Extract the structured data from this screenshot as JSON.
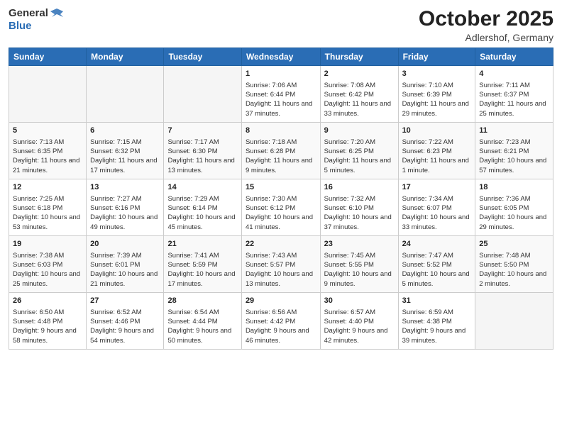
{
  "header": {
    "logo_general": "General",
    "logo_blue": "Blue",
    "month": "October 2025",
    "location": "Adlershof, Germany"
  },
  "weekdays": [
    "Sunday",
    "Monday",
    "Tuesday",
    "Wednesday",
    "Thursday",
    "Friday",
    "Saturday"
  ],
  "weeks": [
    [
      {
        "day": "",
        "sunrise": "",
        "sunset": "",
        "daylight": ""
      },
      {
        "day": "",
        "sunrise": "",
        "sunset": "",
        "daylight": ""
      },
      {
        "day": "",
        "sunrise": "",
        "sunset": "",
        "daylight": ""
      },
      {
        "day": "1",
        "sunrise": "Sunrise: 7:06 AM",
        "sunset": "Sunset: 6:44 PM",
        "daylight": "Daylight: 11 hours and 37 minutes."
      },
      {
        "day": "2",
        "sunrise": "Sunrise: 7:08 AM",
        "sunset": "Sunset: 6:42 PM",
        "daylight": "Daylight: 11 hours and 33 minutes."
      },
      {
        "day": "3",
        "sunrise": "Sunrise: 7:10 AM",
        "sunset": "Sunset: 6:39 PM",
        "daylight": "Daylight: 11 hours and 29 minutes."
      },
      {
        "day": "4",
        "sunrise": "Sunrise: 7:11 AM",
        "sunset": "Sunset: 6:37 PM",
        "daylight": "Daylight: 11 hours and 25 minutes."
      }
    ],
    [
      {
        "day": "5",
        "sunrise": "Sunrise: 7:13 AM",
        "sunset": "Sunset: 6:35 PM",
        "daylight": "Daylight: 11 hours and 21 minutes."
      },
      {
        "day": "6",
        "sunrise": "Sunrise: 7:15 AM",
        "sunset": "Sunset: 6:32 PM",
        "daylight": "Daylight: 11 hours and 17 minutes."
      },
      {
        "day": "7",
        "sunrise": "Sunrise: 7:17 AM",
        "sunset": "Sunset: 6:30 PM",
        "daylight": "Daylight: 11 hours and 13 minutes."
      },
      {
        "day": "8",
        "sunrise": "Sunrise: 7:18 AM",
        "sunset": "Sunset: 6:28 PM",
        "daylight": "Daylight: 11 hours and 9 minutes."
      },
      {
        "day": "9",
        "sunrise": "Sunrise: 7:20 AM",
        "sunset": "Sunset: 6:25 PM",
        "daylight": "Daylight: 11 hours and 5 minutes."
      },
      {
        "day": "10",
        "sunrise": "Sunrise: 7:22 AM",
        "sunset": "Sunset: 6:23 PM",
        "daylight": "Daylight: 11 hours and 1 minute."
      },
      {
        "day": "11",
        "sunrise": "Sunrise: 7:23 AM",
        "sunset": "Sunset: 6:21 PM",
        "daylight": "Daylight: 10 hours and 57 minutes."
      }
    ],
    [
      {
        "day": "12",
        "sunrise": "Sunrise: 7:25 AM",
        "sunset": "Sunset: 6:18 PM",
        "daylight": "Daylight: 10 hours and 53 minutes."
      },
      {
        "day": "13",
        "sunrise": "Sunrise: 7:27 AM",
        "sunset": "Sunset: 6:16 PM",
        "daylight": "Daylight: 10 hours and 49 minutes."
      },
      {
        "day": "14",
        "sunrise": "Sunrise: 7:29 AM",
        "sunset": "Sunset: 6:14 PM",
        "daylight": "Daylight: 10 hours and 45 minutes."
      },
      {
        "day": "15",
        "sunrise": "Sunrise: 7:30 AM",
        "sunset": "Sunset: 6:12 PM",
        "daylight": "Daylight: 10 hours and 41 minutes."
      },
      {
        "day": "16",
        "sunrise": "Sunrise: 7:32 AM",
        "sunset": "Sunset: 6:10 PM",
        "daylight": "Daylight: 10 hours and 37 minutes."
      },
      {
        "day": "17",
        "sunrise": "Sunrise: 7:34 AM",
        "sunset": "Sunset: 6:07 PM",
        "daylight": "Daylight: 10 hours and 33 minutes."
      },
      {
        "day": "18",
        "sunrise": "Sunrise: 7:36 AM",
        "sunset": "Sunset: 6:05 PM",
        "daylight": "Daylight: 10 hours and 29 minutes."
      }
    ],
    [
      {
        "day": "19",
        "sunrise": "Sunrise: 7:38 AM",
        "sunset": "Sunset: 6:03 PM",
        "daylight": "Daylight: 10 hours and 25 minutes."
      },
      {
        "day": "20",
        "sunrise": "Sunrise: 7:39 AM",
        "sunset": "Sunset: 6:01 PM",
        "daylight": "Daylight: 10 hours and 21 minutes."
      },
      {
        "day": "21",
        "sunrise": "Sunrise: 7:41 AM",
        "sunset": "Sunset: 5:59 PM",
        "daylight": "Daylight: 10 hours and 17 minutes."
      },
      {
        "day": "22",
        "sunrise": "Sunrise: 7:43 AM",
        "sunset": "Sunset: 5:57 PM",
        "daylight": "Daylight: 10 hours and 13 minutes."
      },
      {
        "day": "23",
        "sunrise": "Sunrise: 7:45 AM",
        "sunset": "Sunset: 5:55 PM",
        "daylight": "Daylight: 10 hours and 9 minutes."
      },
      {
        "day": "24",
        "sunrise": "Sunrise: 7:47 AM",
        "sunset": "Sunset: 5:52 PM",
        "daylight": "Daylight: 10 hours and 5 minutes."
      },
      {
        "day": "25",
        "sunrise": "Sunrise: 7:48 AM",
        "sunset": "Sunset: 5:50 PM",
        "daylight": "Daylight: 10 hours and 2 minutes."
      }
    ],
    [
      {
        "day": "26",
        "sunrise": "Sunrise: 6:50 AM",
        "sunset": "Sunset: 4:48 PM",
        "daylight": "Daylight: 9 hours and 58 minutes."
      },
      {
        "day": "27",
        "sunrise": "Sunrise: 6:52 AM",
        "sunset": "Sunset: 4:46 PM",
        "daylight": "Daylight: 9 hours and 54 minutes."
      },
      {
        "day": "28",
        "sunrise": "Sunrise: 6:54 AM",
        "sunset": "Sunset: 4:44 PM",
        "daylight": "Daylight: 9 hours and 50 minutes."
      },
      {
        "day": "29",
        "sunrise": "Sunrise: 6:56 AM",
        "sunset": "Sunset: 4:42 PM",
        "daylight": "Daylight: 9 hours and 46 minutes."
      },
      {
        "day": "30",
        "sunrise": "Sunrise: 6:57 AM",
        "sunset": "Sunset: 4:40 PM",
        "daylight": "Daylight: 9 hours and 42 minutes."
      },
      {
        "day": "31",
        "sunrise": "Sunrise: 6:59 AM",
        "sunset": "Sunset: 4:38 PM",
        "daylight": "Daylight: 9 hours and 39 minutes."
      },
      {
        "day": "",
        "sunrise": "",
        "sunset": "",
        "daylight": ""
      }
    ]
  ]
}
